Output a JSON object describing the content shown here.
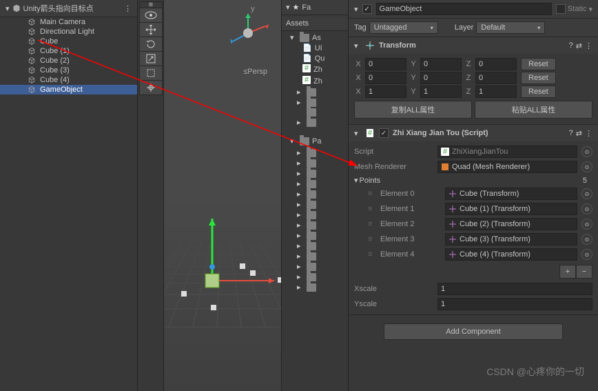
{
  "hierarchy": {
    "title": "Unity箭头指向目标点",
    "items": [
      {
        "name": "Main Camera",
        "icon": "camera"
      },
      {
        "name": "Directional Light",
        "icon": "light"
      },
      {
        "name": "Cube",
        "icon": "cube"
      },
      {
        "name": "Cube (1)",
        "icon": "cube"
      },
      {
        "name": "Cube (2)",
        "icon": "cube"
      },
      {
        "name": "Cube (3)",
        "icon": "cube"
      },
      {
        "name": "Cube (4)",
        "icon": "cube"
      },
      {
        "name": "GameObject",
        "icon": "cube",
        "selected": true
      }
    ]
  },
  "scene": {
    "persp": "≤Persp"
  },
  "project": {
    "favorites": "Fa",
    "assets_root": "As",
    "items": [
      "UI",
      "Qu",
      "Zh",
      "Zh"
    ],
    "packages": "Pa"
  },
  "assets_tab": "Assets",
  "inspector": {
    "name": "GameObject",
    "static_label": "Static",
    "tag_label": "Tag",
    "tag_value": "Untagged",
    "layer_label": "Layer",
    "layer_value": "Default",
    "transform": {
      "title": "Transform",
      "rows": [
        {
          "x": "0",
          "y": "0",
          "z": "0"
        },
        {
          "x": "0",
          "y": "0",
          "z": "0"
        },
        {
          "x": "1",
          "y": "1",
          "z": "1"
        }
      ],
      "x_label": "X",
      "y_label": "Y",
      "z_label": "Z",
      "reset": "Reset",
      "copy_btn": "复制ALL属性",
      "paste_btn": "粘贴ALL属性"
    },
    "script": {
      "title": "Zhi Xiang Jian Tou (Script)",
      "script_label": "Script",
      "script_value": "ZhiXiangJianTou",
      "mesh_label": "Mesh Renderer",
      "mesh_value": "Quad (Mesh Renderer)",
      "points_label": "Points",
      "points_count": "5",
      "elements": [
        {
          "label": "Element 0",
          "value": "Cube (Transform)"
        },
        {
          "label": "Element 1",
          "value": "Cube (1) (Transform)"
        },
        {
          "label": "Element 2",
          "value": "Cube (2) (Transform)"
        },
        {
          "label": "Element 3",
          "value": "Cube (3) (Transform)"
        },
        {
          "label": "Element 4",
          "value": "Cube (4) (Transform)"
        }
      ],
      "xscale_label": "Xscale",
      "xscale_value": "1",
      "yscale_label": "Yscale",
      "yscale_value": "1"
    },
    "add_component": "Add Component"
  },
  "watermark": "CSDN @心疼你的一切"
}
